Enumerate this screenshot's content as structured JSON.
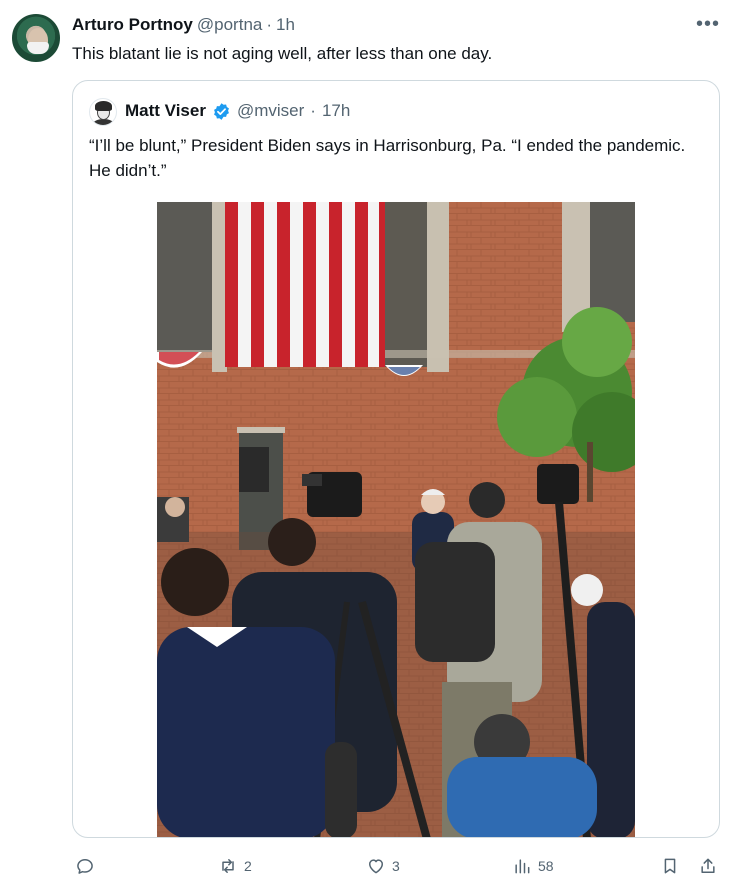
{
  "tweet": {
    "author_name": "Arturo Portnoy",
    "author_handle": "@portna",
    "separator": "·",
    "time": "1h",
    "text": "This blatant lie is not aging well, after less than one day.",
    "more_icon": "more-horizontal-icon"
  },
  "quote": {
    "author_name": "Matt Viser",
    "author_handle": "@mviser",
    "separator": "·",
    "time": "17h",
    "verified_icon": "verified-badge-icon",
    "text": "“I’ll be blunt,” President Biden says in Harrisonburg, Pa. “I ended the pandemic. He didn’t.”",
    "image": "photo-biden-rally"
  },
  "actions": {
    "reply": {
      "icon": "reply-icon",
      "count": ""
    },
    "retweet": {
      "icon": "retweet-icon",
      "count": "2"
    },
    "like": {
      "icon": "heart-icon",
      "count": "3"
    },
    "views": {
      "icon": "views-icon",
      "count": "58"
    },
    "bookmark": {
      "icon": "bookmark-icon"
    },
    "share": {
      "icon": "share-icon"
    }
  },
  "colors": {
    "text": "#0f1419",
    "muted": "#536471",
    "border": "#cfd9de",
    "verified": "#1d9bf0"
  }
}
